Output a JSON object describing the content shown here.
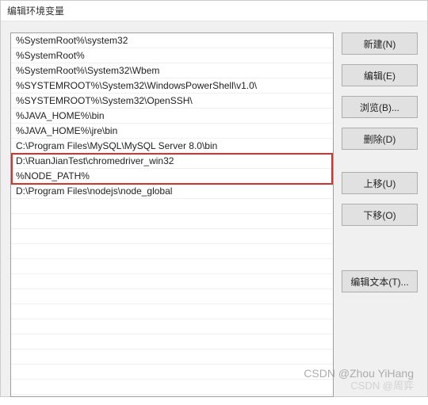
{
  "title": "编辑环境变量",
  "list": {
    "items": [
      "%SystemRoot%\\system32",
      "%SystemRoot%",
      "%SystemRoot%\\System32\\Wbem",
      "%SYSTEMROOT%\\System32\\WindowsPowerShell\\v1.0\\",
      "%SYSTEMROOT%\\System32\\OpenSSH\\",
      "%JAVA_HOME%\\bin",
      "%JAVA_HOME%\\jre\\bin",
      "C:\\Program Files\\MySQL\\MySQL Server 8.0\\bin",
      "D:\\RuanJianTest\\chromedriver_win32",
      "%NODE_PATH%",
      "D:\\Program Files\\nodejs\\node_global"
    ],
    "highlight_range": [
      8,
      9
    ]
  },
  "buttons": {
    "new": "新建(N)",
    "edit": "编辑(E)",
    "browse": "浏览(B)...",
    "delete": "删除(D)",
    "move_up": "上移(U)",
    "move_down": "下移(O)",
    "edit_text": "编辑文本(T)..."
  },
  "watermark": {
    "line1": "CSDN @Zhou YiHang",
    "line2": "CSDN @周弈"
  }
}
